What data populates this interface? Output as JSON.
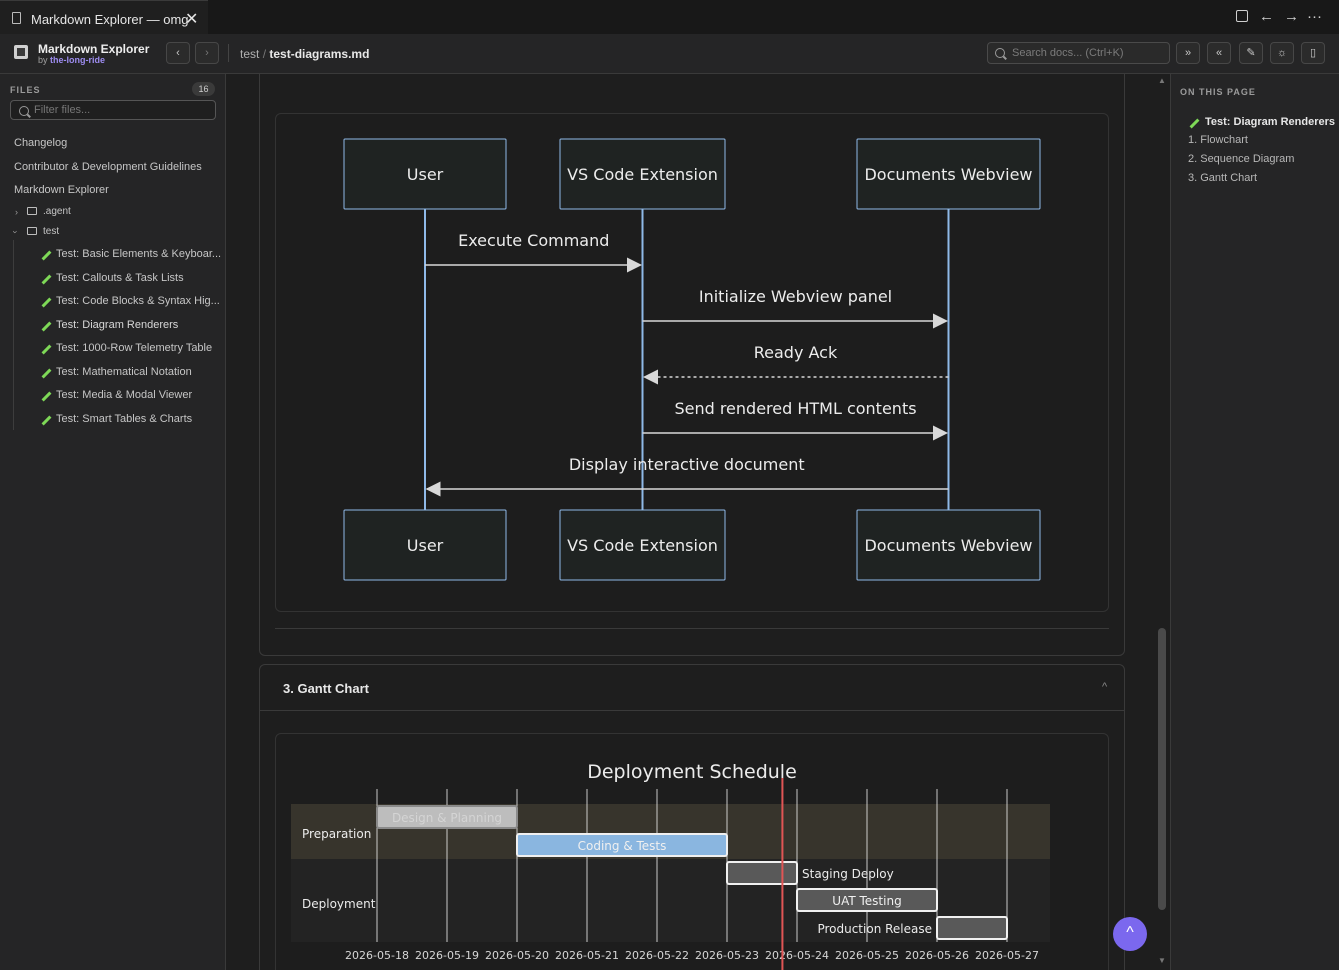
{
  "tab": {
    "title": "Markdown Explorer — omg",
    "close": "✕"
  },
  "window_icons": {
    "split": "split-editor-icon",
    "back": "←",
    "forward": "→",
    "more": "···"
  },
  "toolbar": {
    "app_name": "Markdown Explorer",
    "by_prefix": "by",
    "by_author": "the-long-ride",
    "nav_back": "‹",
    "nav_forward": "›",
    "breadcrumb": {
      "folder": "test",
      "sep": "/",
      "file": "test-diagrams.md"
    },
    "search_placeholder": "Search docs... (Ctrl+K)",
    "buttons": [
      "expand-all-icon",
      "collapse-all-icon",
      "edit-icon",
      "theme-icon",
      "layout-icon"
    ],
    "btn_expand": "»",
    "btn_collapse": "«",
    "btn_edit": "✎",
    "btn_theme": "☼",
    "btn_layout": "▯"
  },
  "sidebar": {
    "files_label": "FILES",
    "files_count": "16",
    "filter_placeholder": "Filter files...",
    "root_files": [
      "Changelog",
      "Contributor & Development Guidelines",
      "Markdown Explorer"
    ],
    "folders": [
      {
        "name": ".agent",
        "expanded": false
      },
      {
        "name": "test",
        "expanded": true
      }
    ],
    "test_files": [
      "Test: Basic Elements & Keyboar...",
      "Test: Callouts & Task Lists",
      "Test: Code Blocks & Syntax Hig...",
      "Test: Diagram Renderers",
      "Test: 1000-Row Telemetry Table",
      "Test: Mathematical Notation",
      "Test: Media & Modal Viewer",
      "Test: Smart Tables & Charts"
    ]
  },
  "sequence": {
    "actors": [
      "User",
      "VS Code Extension",
      "Documents Webview"
    ],
    "messages": [
      {
        "from": 0,
        "to": 1,
        "text": "Execute Command",
        "dashed": false
      },
      {
        "from": 1,
        "to": 2,
        "text": "Initialize Webview panel",
        "dashed": false
      },
      {
        "from": 2,
        "to": 1,
        "text": "Ready Ack",
        "dashed": true
      },
      {
        "from": 1,
        "to": 2,
        "text": "Send rendered HTML contents",
        "dashed": false
      },
      {
        "from": 2,
        "to": 0,
        "text": "Display interactive document",
        "dashed": false
      }
    ]
  },
  "gantt_section": {
    "title": "3. Gantt Chart",
    "chevron": "^"
  },
  "chart_data": {
    "type": "gantt",
    "title": "Deployment Schedule",
    "dates": [
      "2026-05-18",
      "2026-05-19",
      "2026-05-20",
      "2026-05-21",
      "2026-05-22",
      "2026-05-23",
      "2026-05-24",
      "2026-05-25",
      "2026-05-26",
      "2026-05-27"
    ],
    "sections": [
      {
        "name": "Preparation",
        "tasks": [
          {
            "name": "Design & Planning",
            "start": "2026-05-18",
            "end": "2026-05-20",
            "status": "done"
          },
          {
            "name": "Coding & Tests",
            "start": "2026-05-20",
            "end": "2026-05-23",
            "status": "active"
          }
        ]
      },
      {
        "name": "Deployment",
        "tasks": [
          {
            "name": "Staging Deploy",
            "start": "2026-05-23",
            "end": "2026-05-24",
            "status": "pending"
          },
          {
            "name": "UAT Testing",
            "start": "2026-05-24",
            "end": "2026-05-26",
            "status": "pending"
          },
          {
            "name": "Production Release",
            "start": "2026-05-26",
            "end": "2026-05-27",
            "status": "pending"
          }
        ]
      }
    ],
    "today": "2026-05-23T19:00",
    "colors": {
      "done": "#bdbdbd",
      "active": "#8ab6e0",
      "pending": "#595959",
      "today": "#e05555",
      "section_a": "#37342c",
      "section_b": "#232323"
    }
  },
  "toc": {
    "label": "ON THIS PAGE",
    "items": [
      "Test: Diagram Renderers",
      "1. Flowchart",
      "2. Sequence Diagram",
      "3. Gantt Chart"
    ]
  },
  "fab": {
    "icon": "^"
  }
}
